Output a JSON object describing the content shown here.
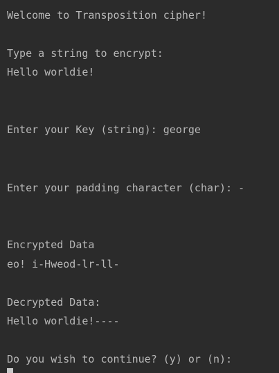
{
  "console": {
    "welcome": "Welcome to Transposition cipher!",
    "prompt_string": "Type a string to encrypt:",
    "input_string": "Hello worldie!",
    "prompt_key": "Enter your Key (string): george",
    "prompt_padding": "Enter your padding character (char): -",
    "encrypted_label": "Encrypted Data",
    "encrypted_value": "eo! i-Hweod-lr-ll-",
    "decrypted_label": "Decrypted Data:",
    "decrypted_value": "Hello worldie!----",
    "prompt_continue": "Do you wish to continue? (y) or (n):"
  }
}
